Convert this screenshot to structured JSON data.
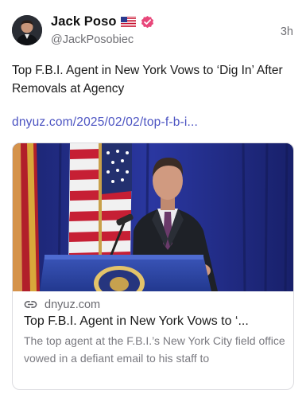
{
  "author": {
    "display_name": "Jack Poso",
    "handle": "@JackPosobiec",
    "flag_icon": "us-flag-icon",
    "verified_icon": "verified-badge-icon",
    "verified_color": "#e8477a"
  },
  "post": {
    "timestamp": "3h",
    "text": "Top F.B.I. Agent in New York Vows to ‘Dig In’ After Removals at Agency",
    "link": "dnyuz.com/2025/02/02/top-f-b-i..."
  },
  "link_card": {
    "domain": "dnyuz.com",
    "title": "Top F.B.I. Agent in New York Vows to ‘...",
    "description": "The top agent at the F.B.I.’s New York City field office vowed in a defiant email to his staff to"
  },
  "colors": {
    "link": "#4b53c2",
    "secondary_text": "#6f6f74"
  }
}
